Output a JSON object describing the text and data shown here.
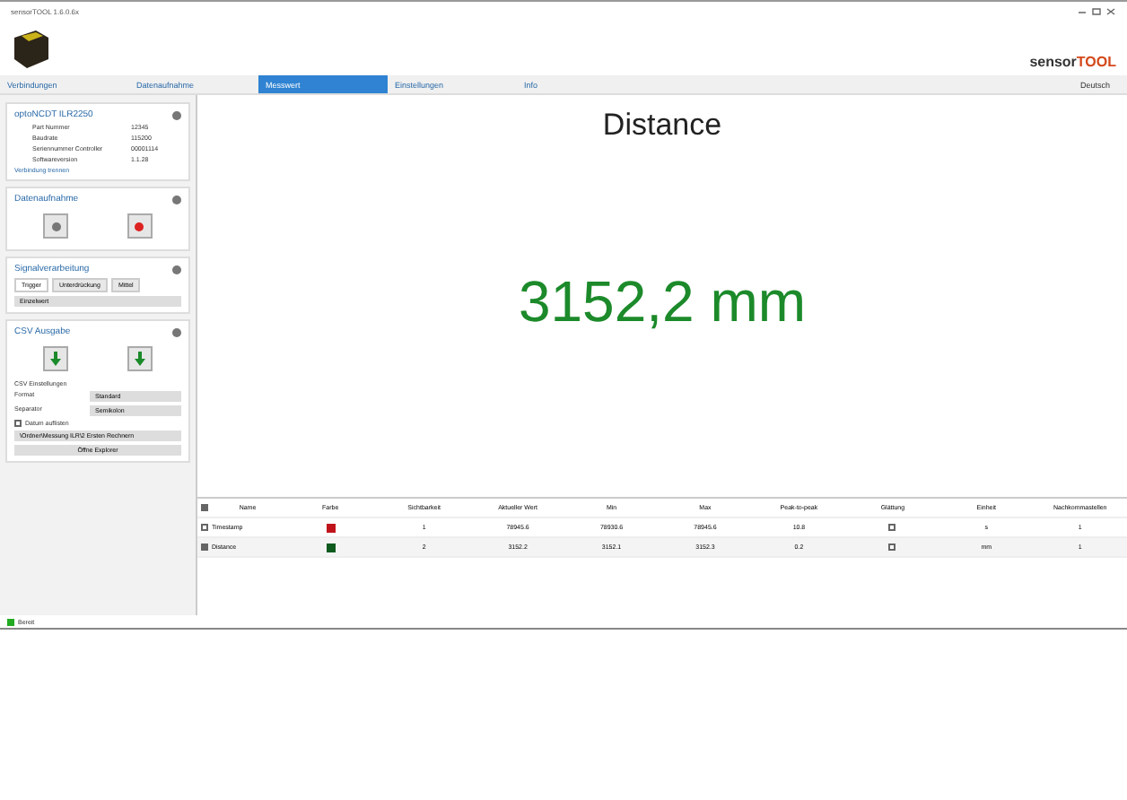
{
  "window": {
    "title": "sensorTOOL 1.6.0.6x"
  },
  "brand": {
    "prefix": "sensor",
    "suffix": "TOOL"
  },
  "tabs": [
    {
      "label": "Verbindungen",
      "selected": false
    },
    {
      "label": "Datenaufnahme",
      "selected": false
    },
    {
      "label": "Messwert",
      "selected": true
    },
    {
      "label": "Einstellungen",
      "selected": false
    },
    {
      "label": "Info",
      "selected": false
    }
  ],
  "language": "Deutsch",
  "sensor_panel": {
    "title": "optoNCDT ILR2250",
    "rows": [
      {
        "label": "Part Nummer",
        "value": "12345"
      },
      {
        "label": "Baudrate",
        "value": "115200"
      },
      {
        "label": "Seriennummer Controller",
        "value": "00001114"
      },
      {
        "label": "Softwareversion",
        "value": "1.1.28"
      }
    ],
    "link": "Verbindung trennen"
  },
  "capture_panel": {
    "title": "Datenaufnahme"
  },
  "signal_panel": {
    "title": "Signalverarbeitung",
    "tabs": [
      {
        "label": "Trigger",
        "selected": true
      },
      {
        "label": "Unterdrückung",
        "selected": false
      },
      {
        "label": "Mittel",
        "selected": false
      }
    ],
    "select": "Einzelwert"
  },
  "csv_panel": {
    "title": "CSV Ausgabe",
    "settings_label": "CSV Einstellungen",
    "fields": [
      {
        "label": "Format",
        "value": "Standard"
      },
      {
        "label": "Separator",
        "value": "Semikolon"
      }
    ],
    "date_option": {
      "label": "Datum auflisten",
      "checked": false
    },
    "path": "\\Ordner\\Messung ILR\\2 Ersten Rechnern",
    "explorer_button": "Öffne Explorer"
  },
  "display": {
    "title": "Distance",
    "value": "3152,2 mm"
  },
  "table": {
    "select_all_checked": true,
    "columns": [
      "Name",
      "Farbe",
      "Sichtbarkeit",
      "Aktueller Wert",
      "Min",
      "Max",
      "Peak-to-peak",
      "Glättung",
      "Einheit",
      "Nachkommastellen"
    ],
    "rows": [
      {
        "checked": false,
        "name": "Timestamp",
        "color": "#c0141c",
        "visibility": "1",
        "current": "78945.6",
        "min": "78930.6",
        "max": "78945.6",
        "peak": "10.8",
        "smoothing": false,
        "unit": "s",
        "decimals": "1"
      },
      {
        "checked": true,
        "name": "Distance",
        "color": "#0f5a1e",
        "visibility": "2",
        "current": "3152.2",
        "min": "3152.1",
        "max": "3152.3",
        "peak": "0.2",
        "smoothing": false,
        "unit": "mm",
        "decimals": "1"
      }
    ]
  },
  "status_bar": {
    "text": "Bereit"
  }
}
